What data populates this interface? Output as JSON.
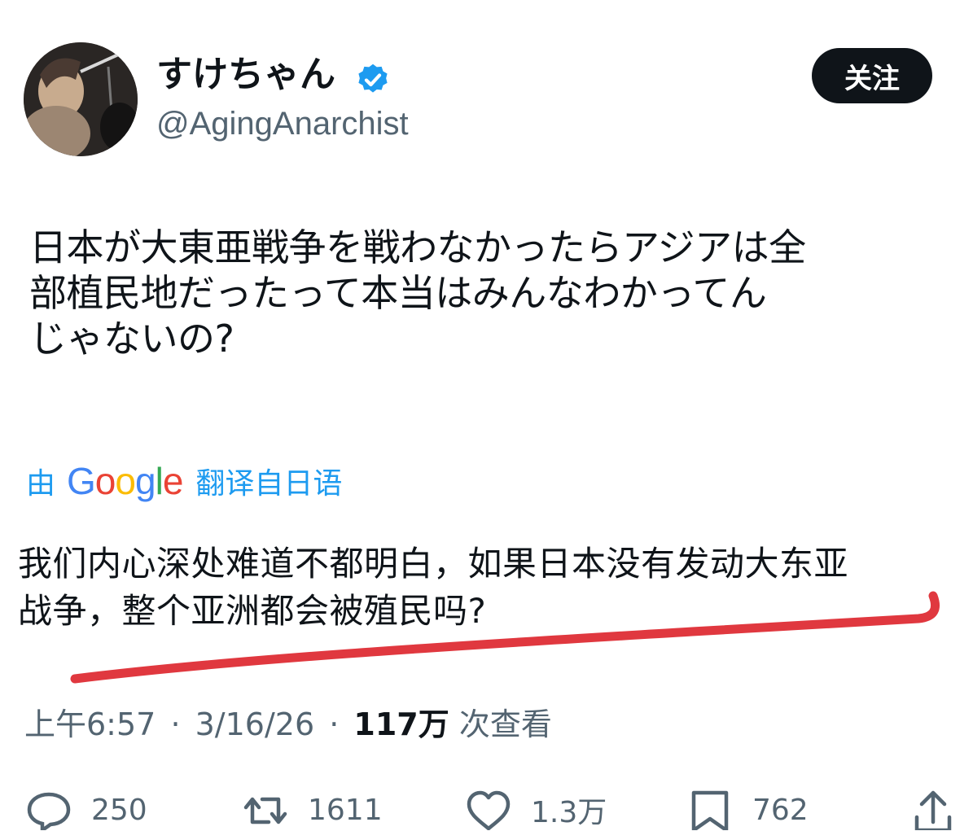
{
  "user": {
    "display_name": "すけちゃん",
    "handle": "@AgingAnarchist",
    "follow_label": "关注"
  },
  "tweet": {
    "lines": [
      "日本が大東亜戦争を戦わなかったらアジアは全",
      "部植民地だったって本当はみんなわかってん",
      "じゃないの?"
    ]
  },
  "translation": {
    "prefix": "由",
    "provider": "Google",
    "suffix": "翻译自日语",
    "lines": [
      "我们内心深处难道不都明白，如果日本没有发动大东亚",
      "战争，整个亚洲都会被殖民吗?"
    ]
  },
  "meta": {
    "time": "上午6:57",
    "separator": "·",
    "date": "3/16/26",
    "views_count": "117万",
    "views_label": "次查看"
  },
  "actions": {
    "reply_count": "250",
    "retweet_count": "1611",
    "like_count": "1.3万",
    "bookmark_count": "762"
  },
  "colors": {
    "link_blue": "#1d9bf0",
    "secondary_text": "#536471",
    "underline_red": "#e0383f"
  }
}
